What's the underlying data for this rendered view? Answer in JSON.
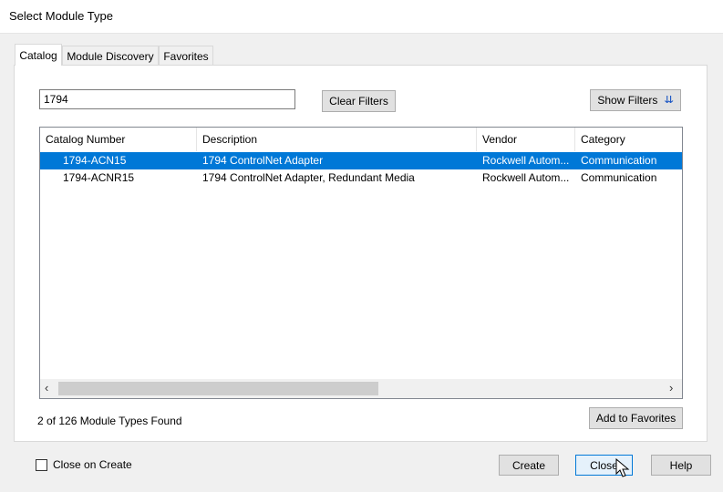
{
  "window": {
    "title": "Select Module Type"
  },
  "tabs": [
    {
      "label": "Catalog",
      "active": true
    },
    {
      "label": "Module Discovery",
      "active": false
    },
    {
      "label": "Favorites",
      "active": false
    }
  ],
  "filter": {
    "search_value": "1794",
    "clear_filters_label": "Clear Filters",
    "show_filters_label": "Show Filters",
    "show_filters_icon": "double-chevron-down-icon"
  },
  "table": {
    "columns": [
      "Catalog Number",
      "Description",
      "Vendor",
      "Category"
    ],
    "rows": [
      {
        "catalog_number": "1794-ACN15",
        "description": "1794 ControlNet Adapter",
        "vendor": "Rockwell Autom...",
        "category": "Communication",
        "selected": true
      },
      {
        "catalog_number": "1794-ACNR15",
        "description": "1794 ControlNet Adapter, Redundant Media",
        "vendor": "Rockwell Autom...",
        "category": "Communication",
        "selected": false
      }
    ]
  },
  "status": {
    "found_text": "2 of 126 Module Types Found"
  },
  "buttons": {
    "add_to_favorites": "Add to Favorites",
    "create": "Create",
    "close": "Close",
    "help": "Help"
  },
  "options": {
    "close_on_create_label": "Close on Create",
    "close_on_create_checked": false
  },
  "colors": {
    "selection": "#0078d7",
    "dialog_bg": "#f0f0f0",
    "panel_bg": "#ffffff"
  }
}
